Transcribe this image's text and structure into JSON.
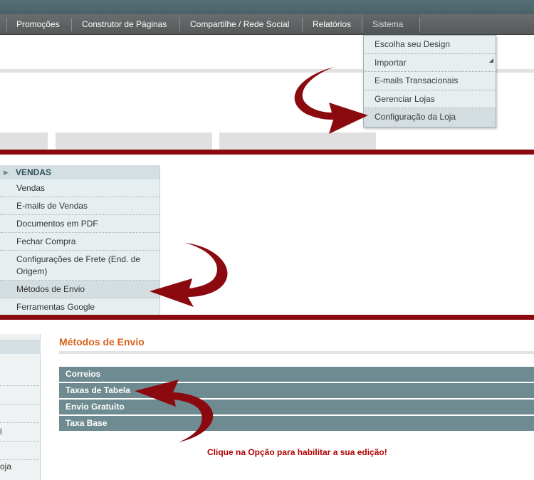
{
  "nav": {
    "items": [
      "Promoções",
      "Construtor de Páginas",
      "Compartilhe / Rede Social",
      "Relatórios",
      "Sistema"
    ],
    "dropdown": [
      "Escolha seu Design",
      "Importar",
      "E-mails Transacionais",
      "Gerenciar Lojas",
      "Configuração da Loja"
    ]
  },
  "sidebar": {
    "header": "VENDAS",
    "items": [
      "Vendas",
      "E-mails de Vendas",
      "Documentos em PDF",
      "Fechar Compra",
      "Configurações de Frete (End. de Origem)",
      "Métodos de Envio",
      "Ferramentas Google"
    ]
  },
  "main": {
    "title": "Métodos de Envio",
    "sections": [
      "Correios",
      "Taxas de Tabela",
      "Envio Gratuito",
      "Taxa Base"
    ],
    "hint": "Clique na Opção para habilitar a sua edição!"
  },
  "colors": {
    "arrow": "#8a0a0f",
    "accent_title": "#d8611d",
    "section_bg": "#6e8b91",
    "divider": "#8a0a0f"
  }
}
